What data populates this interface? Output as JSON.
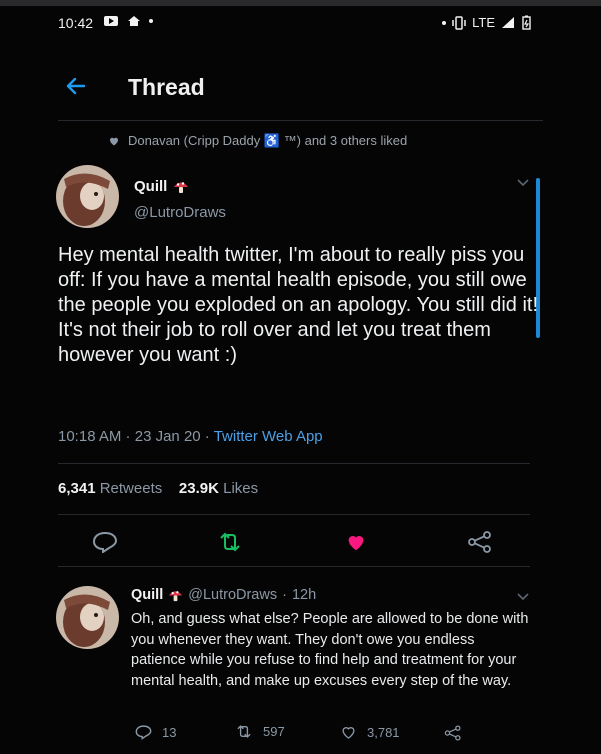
{
  "status_bar": {
    "time": "10:42",
    "network": "LTE"
  },
  "header": {
    "title": "Thread"
  },
  "liked_by": {
    "text": "Donavan (Cripp Daddy ♿ ™) and 3 others liked"
  },
  "main_tweet": {
    "name": "Quill",
    "handle": "@LutroDraws",
    "text": "Hey mental health twitter, I'm about to really piss you off: If you have a mental health episode, you still owe the people you exploded on an apology. You still did it! It's not their job to roll over and let you treat them however you want :)",
    "time": "10:18 AM",
    "date": "23 Jan 20",
    "app": "Twitter Web App",
    "retweets_count": "6,341",
    "retweets_label": "Retweets",
    "likes_count": "23.9K",
    "likes_label": "Likes"
  },
  "reply": {
    "name": "Quill",
    "handle": "@LutroDraws",
    "age": "12h",
    "text": "Oh, and guess what else? People are allowed to be done with you whenever they want. They don't owe you endless patience while you refuse to find help and treatment for your mental health, and make up excuses every step of the way.",
    "replies": "13",
    "retweets": "597",
    "likes": "3,781"
  },
  "colors": {
    "accent": "#1d9bf0",
    "like": "#f91880",
    "retweet": "#17bf63"
  },
  "icons": [
    "back-arrow-icon",
    "heart-icon",
    "reply-icon",
    "retweet-icon",
    "share-icon",
    "chevron-down-icon",
    "mushroom-emoji-icon"
  ]
}
